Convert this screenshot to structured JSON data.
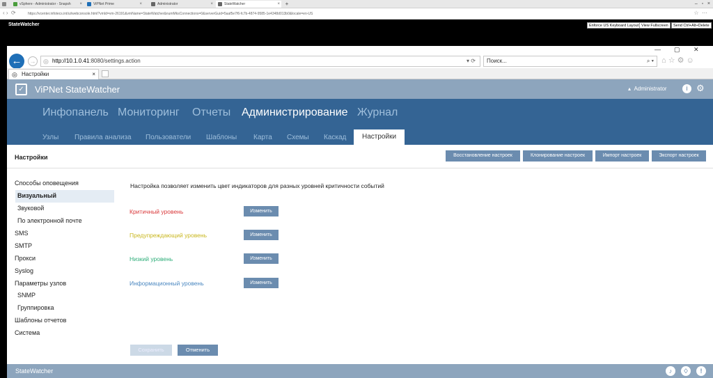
{
  "outer": {
    "tabs": [
      {
        "label": "vSphere - Administrator - Snapsh",
        "color": "#4a9d3c"
      },
      {
        "label": "ViPNet Prime",
        "color": "#1f6fb7"
      },
      {
        "label": "Administrator",
        "color": "#666666"
      },
      {
        "label": "StateWatcher",
        "color": "#666666"
      }
    ],
    "url": "https://vcenter.infotecs.int/ui/webconsole.html?vmId=vm-26191&vmName=StateWatcher&numMksConnections=0&serverGuid=5aaf5e7f6-fc7b-4874-9585-1e4348d013b0&locale=en-US",
    "rdp_title": "StateWatcher",
    "rdp_buttons": [
      "Enforce US Keyboard Layout",
      "View Fullscreen",
      "Send Ctrl+Alt+Delete"
    ]
  },
  "browser": {
    "url_host": "http://10.1.0.41",
    "url_rest": ":8080/settings.action",
    "search_placeholder": "Поиск...",
    "tab_label": "Настройки"
  },
  "app": {
    "title": "ViPNet StateWatcher",
    "user": "Administrator",
    "main_nav": [
      "Инфопанель",
      "Мониторинг",
      "Отчеты",
      "Администрирование",
      "Журнал"
    ],
    "sub_nav": [
      "Узлы",
      "Правила анализа",
      "Пользователи",
      "Шаблоны",
      "Карта",
      "Схемы",
      "Каскад",
      "Настройки"
    ],
    "page_title": "Настройки",
    "header_buttons": [
      "Восстановление настроек",
      "Клонирование настроек",
      "Импорт настроек",
      "Экспорт настроек"
    ],
    "sidebar": [
      "Способы оповещения",
      "Визуальный",
      "Звуковой",
      "По электронной почте",
      "SMS",
      "SMTP",
      "Прокси",
      "Syslog",
      "Параметры узлов",
      "SNMP",
      "Группировка",
      "Шаблоны отчетов",
      "Система"
    ],
    "description": "Настройка позволяет изменить цвет индикаторов для разных уровней критичности событий",
    "levels": [
      {
        "label": "Критичный уровень",
        "color": "#d9383a",
        "button": "Изменить"
      },
      {
        "label": "Предупреждающий уровень",
        "color": "#c9b71f",
        "button": "Изменить"
      },
      {
        "label": "Низкий уровень",
        "color": "#2fae7a",
        "button": "Изменить"
      },
      {
        "label": "Информационный уровень",
        "color": "#4a87c0",
        "button": "Изменить"
      }
    ],
    "save": "Сохранить",
    "cancel": "Отменить",
    "footer": "StateWatcher"
  }
}
